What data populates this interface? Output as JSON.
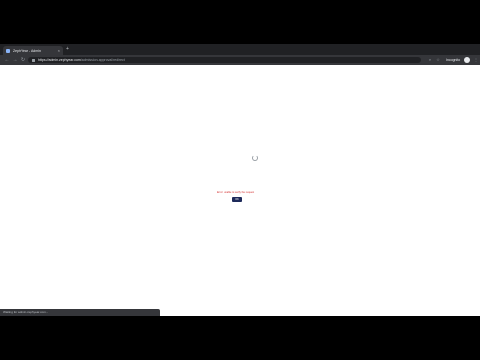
{
  "browser": {
    "tab_title": "ZephYear - Admin",
    "tab_close_glyph": "×",
    "new_tab_glyph": "+",
    "url_host": "https://admin.zephyear.com",
    "url_path": "/admission-approval/redirect",
    "profile_label": "Incognito",
    "menu_glyph": "⋮"
  },
  "page": {
    "error_message": "Error: unable to verify the request",
    "ok_button_label": "OK"
  },
  "status_bar": {
    "text": "Waiting for admin.zephyear.com..."
  },
  "colors": {
    "accent": "#1e2a5a",
    "error": "#d32f2f"
  }
}
